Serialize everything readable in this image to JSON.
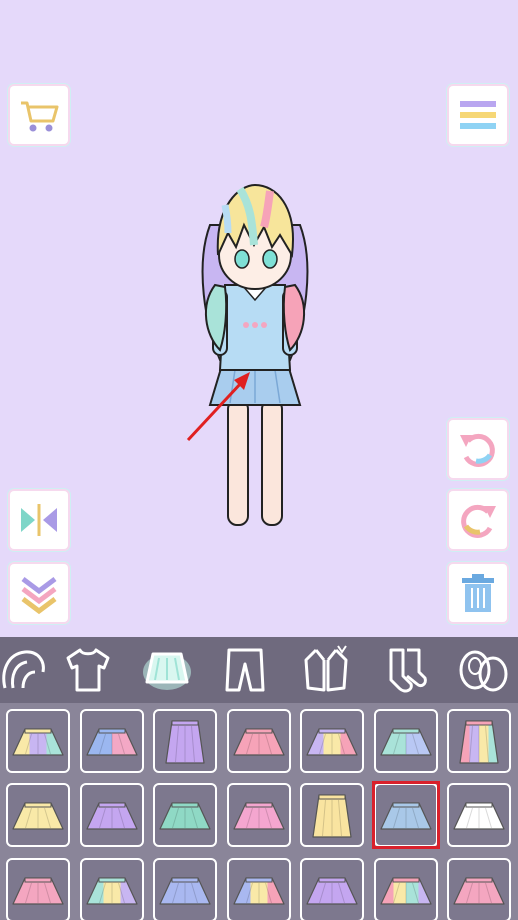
{
  "toolbar": {
    "left": [
      {
        "name": "shop-cart-button",
        "icon": "cart-icon"
      },
      {
        "name": "flip-button",
        "icon": "flip-horizontal-icon"
      },
      {
        "name": "collapse-button",
        "icon": "chevrons-down-icon"
      }
    ],
    "right": [
      {
        "name": "menu-button",
        "icon": "hamburger-menu-icon"
      },
      {
        "name": "undo-button",
        "icon": "undo-icon"
      },
      {
        "name": "redo-button",
        "icon": "redo-icon"
      },
      {
        "name": "trash-button",
        "icon": "trash-icon"
      }
    ]
  },
  "categories": [
    {
      "name": "hair",
      "icon": "hair-icon",
      "active": false
    },
    {
      "name": "top",
      "icon": "shirt-icon",
      "active": false
    },
    {
      "name": "skirt",
      "icon": "skirt-icon",
      "active": true
    },
    {
      "name": "pants",
      "icon": "pants-icon",
      "active": false
    },
    {
      "name": "outerwear",
      "icon": "jacket-icon",
      "active": false
    },
    {
      "name": "socks",
      "icon": "socks-icon",
      "active": false
    },
    {
      "name": "shoes",
      "icon": "shoes-icon",
      "active": false
    }
  ],
  "items": [
    {
      "icon": "tiered-skirt-icon",
      "colors": [
        "#f9e9a8",
        "#c8b6f2",
        "#a9e3d9"
      ]
    },
    {
      "icon": "ruffle-skirt-icon",
      "colors": [
        "#9bb7f0",
        "#f3a8c5"
      ]
    },
    {
      "icon": "long-skirt-icon",
      "colors": [
        "#c4a6f0"
      ]
    },
    {
      "icon": "pleated-skirt-icon",
      "colors": [
        "#f6a3b8"
      ]
    },
    {
      "icon": "striped-wrap-skirt-icon",
      "colors": [
        "#c8b6f2",
        "#f9e9a8",
        "#f6a3b8"
      ]
    },
    {
      "icon": "layered-skirt-icon",
      "colors": [
        "#a9e3d9",
        "#b9c8f4"
      ]
    },
    {
      "icon": "rainbow-long-skirt-icon",
      "colors": [
        "#f6a3b8",
        "#c8b6f2",
        "#f9e9a8",
        "#a9e3d9"
      ]
    },
    {
      "icon": "flare-skirt-icon",
      "colors": [
        "#f9e9a8"
      ]
    },
    {
      "icon": "mini-skirt-icon",
      "colors": [
        "#c4a6f0"
      ]
    },
    {
      "icon": "button-skirt-icon",
      "colors": [
        "#8fd9c5"
      ]
    },
    {
      "icon": "pleated-skirt-icon",
      "colors": [
        "#f4a6cf"
      ]
    },
    {
      "icon": "long-pleated-skirt-icon",
      "colors": [
        "#f9e4a0"
      ]
    },
    {
      "icon": "short-pleated-skirt-icon",
      "colors": [
        "#a9c8e8"
      ],
      "selected": true
    },
    {
      "icon": "white-skirt-icon",
      "colors": [
        "#ffffff"
      ]
    },
    {
      "icon": "bubble-skirt-icon",
      "colors": [
        "#f4a6c0"
      ]
    },
    {
      "icon": "rainbow-pleated-skirt-icon",
      "colors": [
        "#a9e3d9",
        "#f9e9a8",
        "#c8b6f2"
      ]
    },
    {
      "icon": "pleated-skirt-icon",
      "colors": [
        "#a9b8f0"
      ]
    },
    {
      "icon": "diagonal-skirt-icon",
      "colors": [
        "#a9b8f0",
        "#f9e9a8",
        "#f6a3b8"
      ]
    },
    {
      "icon": "pleated-skirt-icon",
      "colors": [
        "#c4a6f0"
      ]
    },
    {
      "icon": "rainbow-mini-skirt-icon",
      "colors": [
        "#f6a3b8",
        "#f9e9a8",
        "#a9e3d9",
        "#c8b6f2"
      ]
    },
    {
      "icon": "ruffle-mini-skirt-icon",
      "colors": [
        "#f4a6c0"
      ]
    }
  ],
  "colors": {
    "background": "#e5d9fa",
    "category_bar": "#6f6a7e",
    "grid_background": "#8a8599",
    "selection": "#d9212b",
    "annotation_arrow": "#e02020"
  }
}
